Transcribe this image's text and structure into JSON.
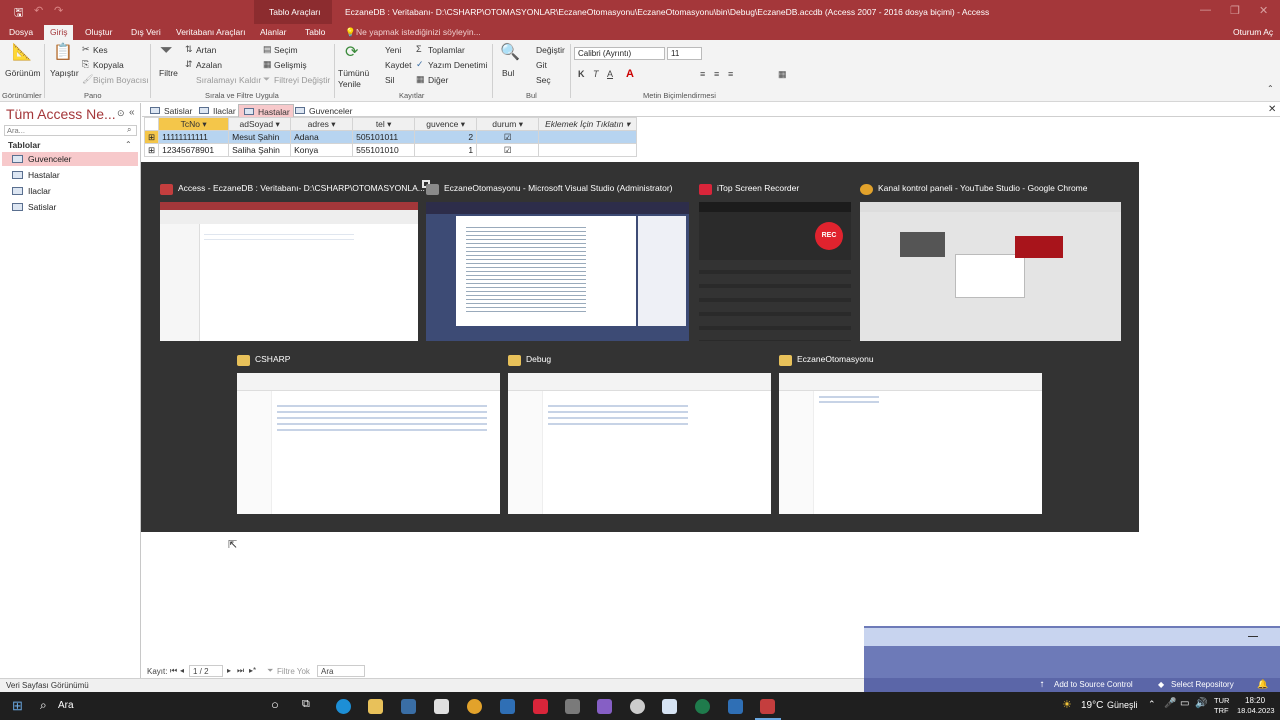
{
  "titlebar": {
    "context_tab": "Tablo Araçları",
    "title": "EczaneDB : Veritabanı- D:\\CSHARP\\OTOMASYONLAR\\EczaneOtomasyonu\\EczaneOtomasyonu\\bin\\Debug\\EczaneDB.accdb (Access 2007 - 2016 dosya biçimi) - Access"
  },
  "menus": [
    "Dosya",
    "Giriş",
    "Oluştur",
    "Dış Veri",
    "Veritabanı Araçları",
    "Alanlar",
    "Tablo"
  ],
  "tell_me": "Ne yapmak istediğinizi söyleyin...",
  "account": "Oturum Aç",
  "ribbon": {
    "views": "Görünüm",
    "paste": "Yapıştır",
    "cut": "Kes",
    "copy": "Kopyala",
    "format_painter": "Biçim Boyacısı",
    "filter": "Filtre",
    "asc": "Artan",
    "desc": "Azalan",
    "remove_sort": "Sıralamayı Kaldır",
    "selection": "Seçim",
    "advanced": "Gelişmiş",
    "toggle_filter": "Filtreyi Değiştir",
    "refresh_all": "Tümünü Yenile",
    "new": "Yeni",
    "save": "Kaydet",
    "delete": "Sil",
    "totals": "Toplamlar",
    "spelling": "Yazım Denetimi",
    "more": "Diğer",
    "find": "Bul",
    "replace": "Değiştir",
    "goto": "Git",
    "select": "Seç",
    "font_name": "Calibri (Ayrıntı)",
    "font_size": "11",
    "groups": [
      "Görünümler",
      "Pano",
      "Sırala ve Filtre Uygula",
      "Kayıtlar",
      "Bul",
      "Metin Biçimlendirmesi"
    ]
  },
  "nav": {
    "title": "Tüm Access Ne...",
    "search_placeholder": "Ara...",
    "section": "Tablolar",
    "items": [
      "Guvenceler",
      "Hastalar",
      "Ilaclar",
      "Satislar"
    ]
  },
  "doc_tabs": [
    "Satislar",
    "Ilaclar",
    "Hastalar",
    "Guvenceler"
  ],
  "grid": {
    "headers": [
      "TcNo",
      "adSoyad",
      "adres",
      "tel",
      "guvence",
      "durum",
      "Eklemek İçin Tıklatın"
    ],
    "rows": [
      [
        "11111111111",
        "Mesut Şahin",
        "Adana",
        "505101011",
        "2"
      ],
      [
        "12345678901",
        "Saliha Şahin",
        "Konya",
        "555101010",
        "1"
      ]
    ]
  },
  "switcher": {
    "windows": [
      {
        "title": "Access - EczaneDB : Veritabanı- D:\\CSHARP\\OTOMASYONLA...",
        "icon_color": "#c43e3e"
      },
      {
        "title": "EczaneOtomasyonu - Microsoft Visual Studio (Administrator)",
        "icon_color": "#8a8a8a"
      },
      {
        "title": "iTop Screen Recorder",
        "icon_color": "#d9253a"
      },
      {
        "title": "Kanal kontrol paneli - YouTube Studio - Google Chrome",
        "icon_color": "#e2a22b"
      },
      {
        "title": "CSHARP",
        "icon_color": "#e8c15a"
      },
      {
        "title": "Debug",
        "icon_color": "#e8c15a"
      },
      {
        "title": "EczaneOtomasyonu",
        "icon_color": "#e8c15a"
      }
    ],
    "rec_label": "REC"
  },
  "record_nav": {
    "label": "Kayıt:",
    "position": "1 / 2",
    "filter": "Filtre Yok",
    "search": "Ara"
  },
  "status": {
    "left": "Veri Sayfası Görünümü",
    "source_control": "Add to Source Control",
    "repo": "Select Repository"
  },
  "taskbar": {
    "search": "Ara",
    "weather": "19°C",
    "weather_text": "Güneşli",
    "lang1": "TUR",
    "lang2": "TRF",
    "time": "18:20",
    "date": "18.04.2023"
  }
}
